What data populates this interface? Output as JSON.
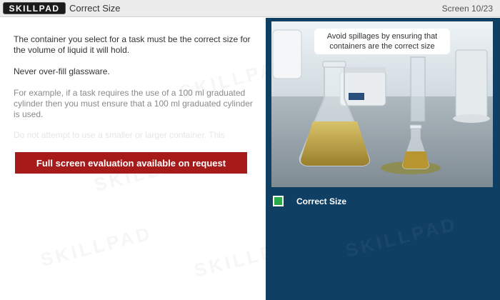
{
  "header": {
    "logo": "SKILLPAD",
    "title": "Correct Size",
    "screen_counter": "Screen 10/23"
  },
  "content": {
    "p1": "The container you select for a task must be the correct size for the volume of liquid it will hold.",
    "p2": "Never over-fill glassware.",
    "p3": "For example, if a task requires the use of a 100 ml graduated cylinder then you must ensure that a 100 ml graduated cylinder is used.",
    "p4": "Do not attempt to use a smaller or larger container. This",
    "eval_button": "Full screen evaluation available on request"
  },
  "media": {
    "callout": "Avoid spillages by ensuring that containers are the correct size",
    "caption": "Correct Size"
  },
  "watermark": "SKILLPAD",
  "colors": {
    "panel": "#0f3f63",
    "button": "#a71a1a",
    "indicator": "#2aa84a"
  }
}
